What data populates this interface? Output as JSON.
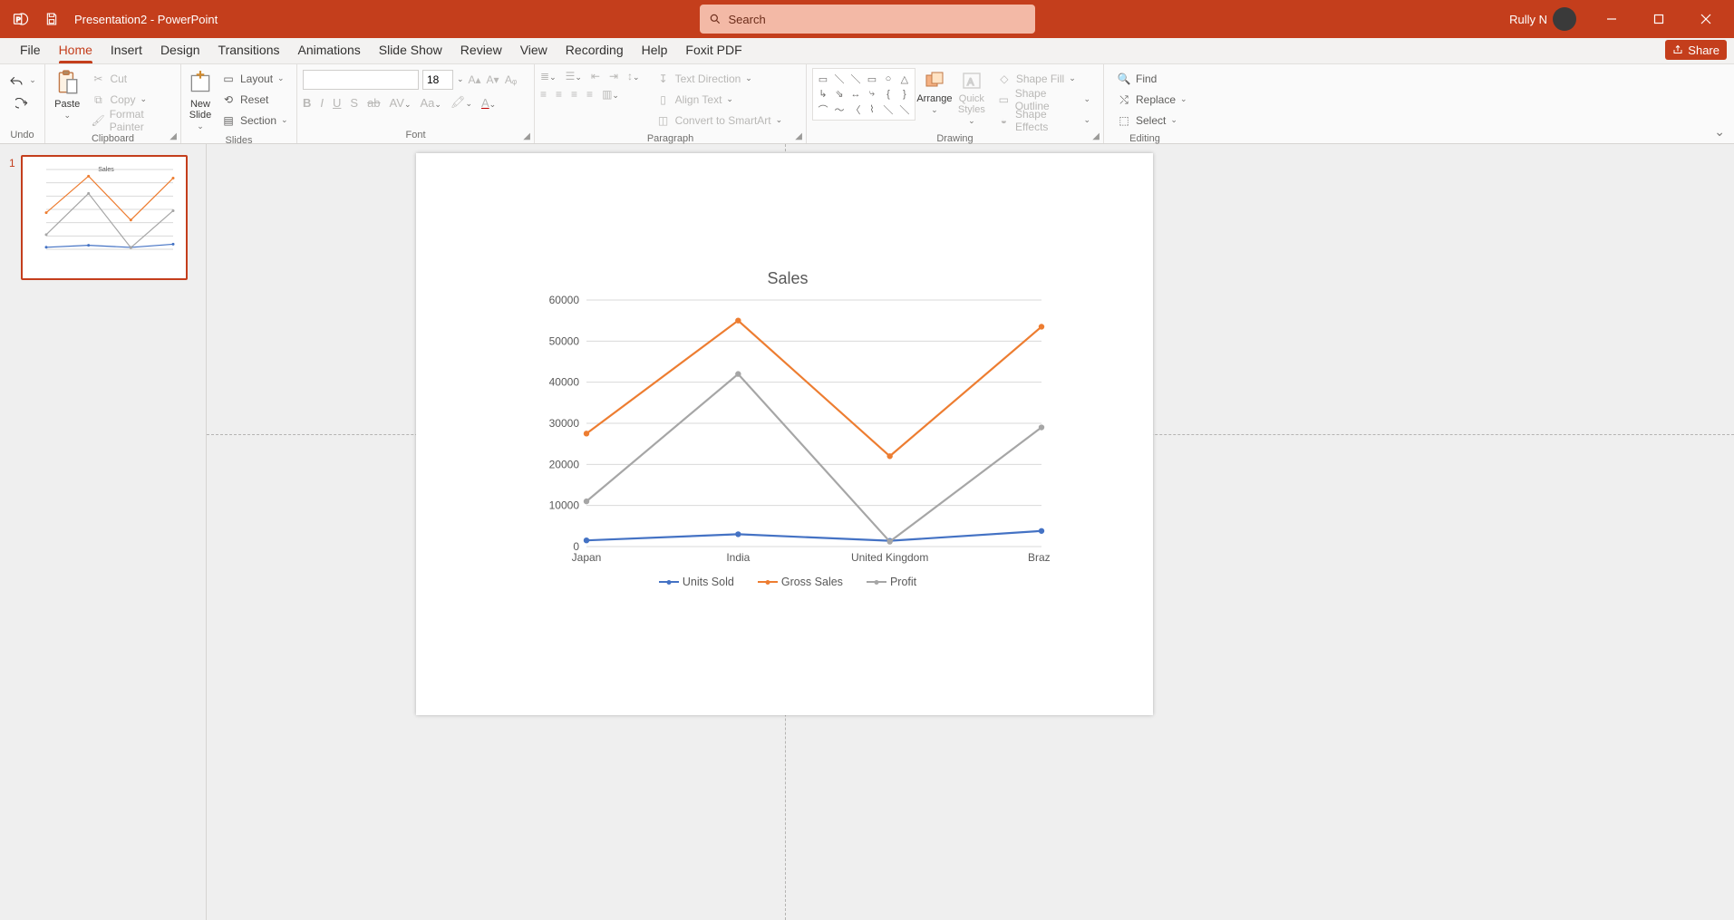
{
  "app": {
    "filename": "Presentation2",
    "suffix": "  -  PowerPoint",
    "search_placeholder": "Search",
    "user": "Rully N"
  },
  "tabs": [
    "File",
    "Home",
    "Insert",
    "Design",
    "Transitions",
    "Animations",
    "Slide Show",
    "Review",
    "View",
    "Recording",
    "Help",
    "Foxit PDF"
  ],
  "tabs_active": "Home",
  "share_label": "Share",
  "ribbon": {
    "undo_group": "Undo",
    "clipboard": {
      "paste": "Paste",
      "cut": "Cut",
      "copy": "Copy",
      "fmt": "Format Painter",
      "group": "Clipboard"
    },
    "slides": {
      "new": "New\nSlide",
      "layout": "Layout",
      "reset": "Reset",
      "section": "Section",
      "group": "Slides"
    },
    "font": {
      "size": "18",
      "group": "Font"
    },
    "para": {
      "textdir": "Text Direction",
      "align": "Align Text",
      "smartart": "Convert to SmartArt",
      "group": "Paragraph"
    },
    "drawing": {
      "arrange": "Arrange",
      "quick": "Quick\nStyles",
      "fill": "Shape Fill",
      "outline": "Shape Outline",
      "effects": "Shape Effects",
      "group": "Drawing"
    },
    "editing": {
      "find": "Find",
      "replace": "Replace",
      "select": "Select",
      "group": "Editing"
    }
  },
  "thumb_number": "1",
  "chart_data": {
    "type": "line",
    "title": "Sales",
    "categories": [
      "Japan",
      "India",
      "United Kingdom",
      "Brazil"
    ],
    "yticks": [
      0,
      10000,
      20000,
      30000,
      40000,
      50000,
      60000
    ],
    "ylim": [
      0,
      60000
    ],
    "series": [
      {
        "name": "Units Sold",
        "color": "#4472c4",
        "values": [
          1500,
          3000,
          1400,
          3800
        ]
      },
      {
        "name": "Gross Sales",
        "color": "#ed7d31",
        "values": [
          27500,
          55000,
          22000,
          53500
        ]
      },
      {
        "name": "Profit",
        "color": "#a6a6a6",
        "values": [
          11000,
          42000,
          1200,
          29000
        ]
      }
    ]
  }
}
